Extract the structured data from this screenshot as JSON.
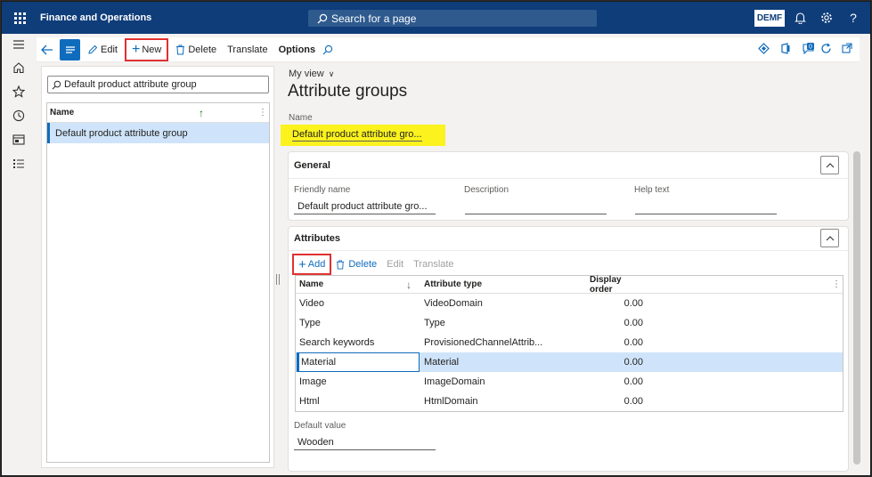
{
  "topbar": {
    "app_title": "Finance and Operations",
    "search_placeholder": "Search for a page",
    "company": "DEMF",
    "icons": [
      "waffle-icon",
      "search-icon",
      "bell-icon",
      "gear-icon",
      "help-icon"
    ]
  },
  "leftnav": {
    "icons": [
      "hamburger-icon",
      "home-icon",
      "star-icon",
      "clock-icon",
      "workspace-icon",
      "list-icon"
    ]
  },
  "actionpane": {
    "edit_label": "Edit",
    "new_label": "New",
    "delete_label": "Delete",
    "translate_label": "Translate",
    "options_label": "Options",
    "badge_count": "0"
  },
  "listpanel": {
    "filter_value": "Default product attribute group",
    "column_name": "Name",
    "rows": [
      "Default product attribute group"
    ]
  },
  "main": {
    "view_label": "My view",
    "title": "Attribute groups",
    "name_label": "Name",
    "name_value": "Default product attribute gro..."
  },
  "general": {
    "title": "General",
    "friendly_name_label": "Friendly name",
    "friendly_name_value": "Default product attribute gro...",
    "description_label": "Description",
    "description_value": "",
    "help_text_label": "Help text",
    "help_text_value": ""
  },
  "attributes": {
    "title": "Attributes",
    "add_label": "Add",
    "delete_label": "Delete",
    "edit_label": "Edit",
    "translate_label": "Translate",
    "columns": [
      "Name",
      "Attribute type",
      "Display order"
    ],
    "rows": [
      {
        "name": "Video",
        "type": "VideoDomain",
        "order": "0.00"
      },
      {
        "name": "Type",
        "type": "Type",
        "order": "0.00"
      },
      {
        "name": "Search keywords",
        "type": "ProvisionedChannelAttrib...",
        "order": "0.00"
      },
      {
        "name": "Material",
        "type": "Material",
        "order": "0.00"
      },
      {
        "name": "Image",
        "type": "ImageDomain",
        "order": "0.00"
      },
      {
        "name": "Html",
        "type": "HtmlDomain",
        "order": "0.00"
      }
    ],
    "selected_index": 3,
    "default_value_label": "Default value",
    "default_value": "Wooden"
  },
  "colors": {
    "topbar": "#0f3d7a",
    "accent": "#0f6cbd",
    "highlight": "#fbf21e",
    "callout": "#e03131",
    "selection": "#cfe4fa"
  }
}
